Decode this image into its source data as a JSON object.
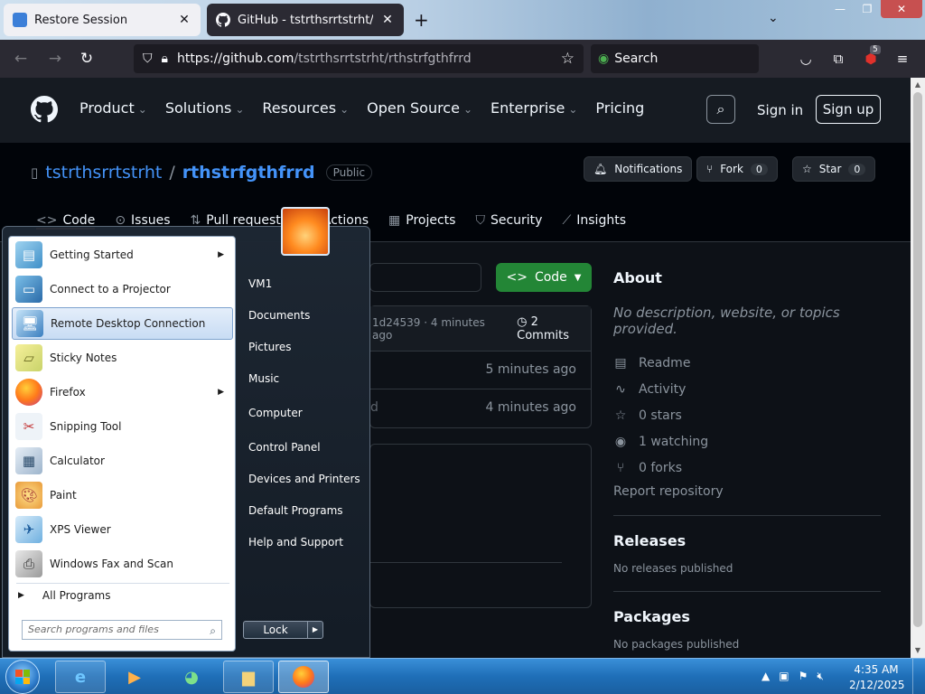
{
  "browser": {
    "tabs": [
      {
        "title": "Restore Session",
        "active": false
      },
      {
        "title": "GitHub - tstrthsrrtstrht/rthstrfgthfrrd",
        "active": true
      }
    ],
    "url_host": "https://github.com",
    "url_path": "/tstrthsrrtstrht/rthstrfgthfrrd",
    "search_placeholder": "Search",
    "extension_badge": "5"
  },
  "github": {
    "nav": [
      "Product",
      "Solutions",
      "Resources",
      "Open Source",
      "Enterprise",
      "Pricing"
    ],
    "sign_in": "Sign in",
    "sign_up": "Sign up",
    "owner": "tstrthsrrtstrht",
    "separator": "/",
    "repo": "rthstrfgthfrrd",
    "visibility": "Public",
    "notifications": "Notifications",
    "fork_label": "Fork",
    "fork_count": "0",
    "star_label": "Star",
    "star_count": "0",
    "tabs": [
      "Code",
      "Issues",
      "Pull requests",
      "Actions",
      "Projects",
      "Security",
      "Insights"
    ],
    "code_button": "Code",
    "commit_hash": "1d24539 · 4 minutes ago",
    "commits_link": "2 Commits",
    "file_rows": [
      {
        "time": "5 minutes ago"
      },
      {
        "ghost": "d",
        "time": "4 minutes ago"
      }
    ],
    "about": {
      "heading": "About",
      "description": "No description, website, or topics provided.",
      "items": [
        {
          "icon": "book-icon",
          "label": "Readme"
        },
        {
          "icon": "pulse-icon",
          "label": "Activity"
        },
        {
          "icon": "star-icon",
          "label": "0 stars"
        },
        {
          "icon": "eye-icon",
          "label": "1 watching"
        },
        {
          "icon": "fork-icon",
          "label": "0 forks"
        }
      ],
      "report": "Report repository",
      "releases_heading": "Releases",
      "releases_text": "No releases published",
      "packages_heading": "Packages",
      "packages_text": "No packages published"
    }
  },
  "start_menu": {
    "programs": [
      {
        "label": "Getting Started",
        "icon": "getting-started-icon",
        "submenu": true
      },
      {
        "label": "Connect to a Projector",
        "icon": "projector-icon",
        "submenu": false
      },
      {
        "label": "Remote Desktop Connection",
        "icon": "remote-desktop-icon",
        "submenu": false,
        "highlighted": true
      },
      {
        "label": "Sticky Notes",
        "icon": "sticky-notes-icon",
        "submenu": false
      },
      {
        "label": "Firefox",
        "icon": "firefox-icon",
        "submenu": true
      },
      {
        "label": "Snipping Tool",
        "icon": "snipping-tool-icon",
        "submenu": false
      },
      {
        "label": "Calculator",
        "icon": "calculator-icon",
        "submenu": false
      },
      {
        "label": "Paint",
        "icon": "paint-icon",
        "submenu": false
      },
      {
        "label": "XPS Viewer",
        "icon": "xps-viewer-icon",
        "submenu": false
      },
      {
        "label": "Windows Fax and Scan",
        "icon": "fax-scan-icon",
        "submenu": false
      }
    ],
    "all_programs": "All Programs",
    "search_placeholder": "Search programs and files",
    "links": [
      "VM1",
      "Documents",
      "Pictures",
      "Music",
      "Computer",
      "Control Panel",
      "Devices and Printers",
      "Default Programs",
      "Help and Support"
    ],
    "lock_label": "Lock"
  },
  "taskbar": {
    "apps": [
      "internet-explorer-icon",
      "media-player-icon",
      "windows-live-icon",
      "explorer-folder-icon",
      "firefox-icon"
    ],
    "time": "4:35 AM",
    "date": "2/12/2025"
  }
}
